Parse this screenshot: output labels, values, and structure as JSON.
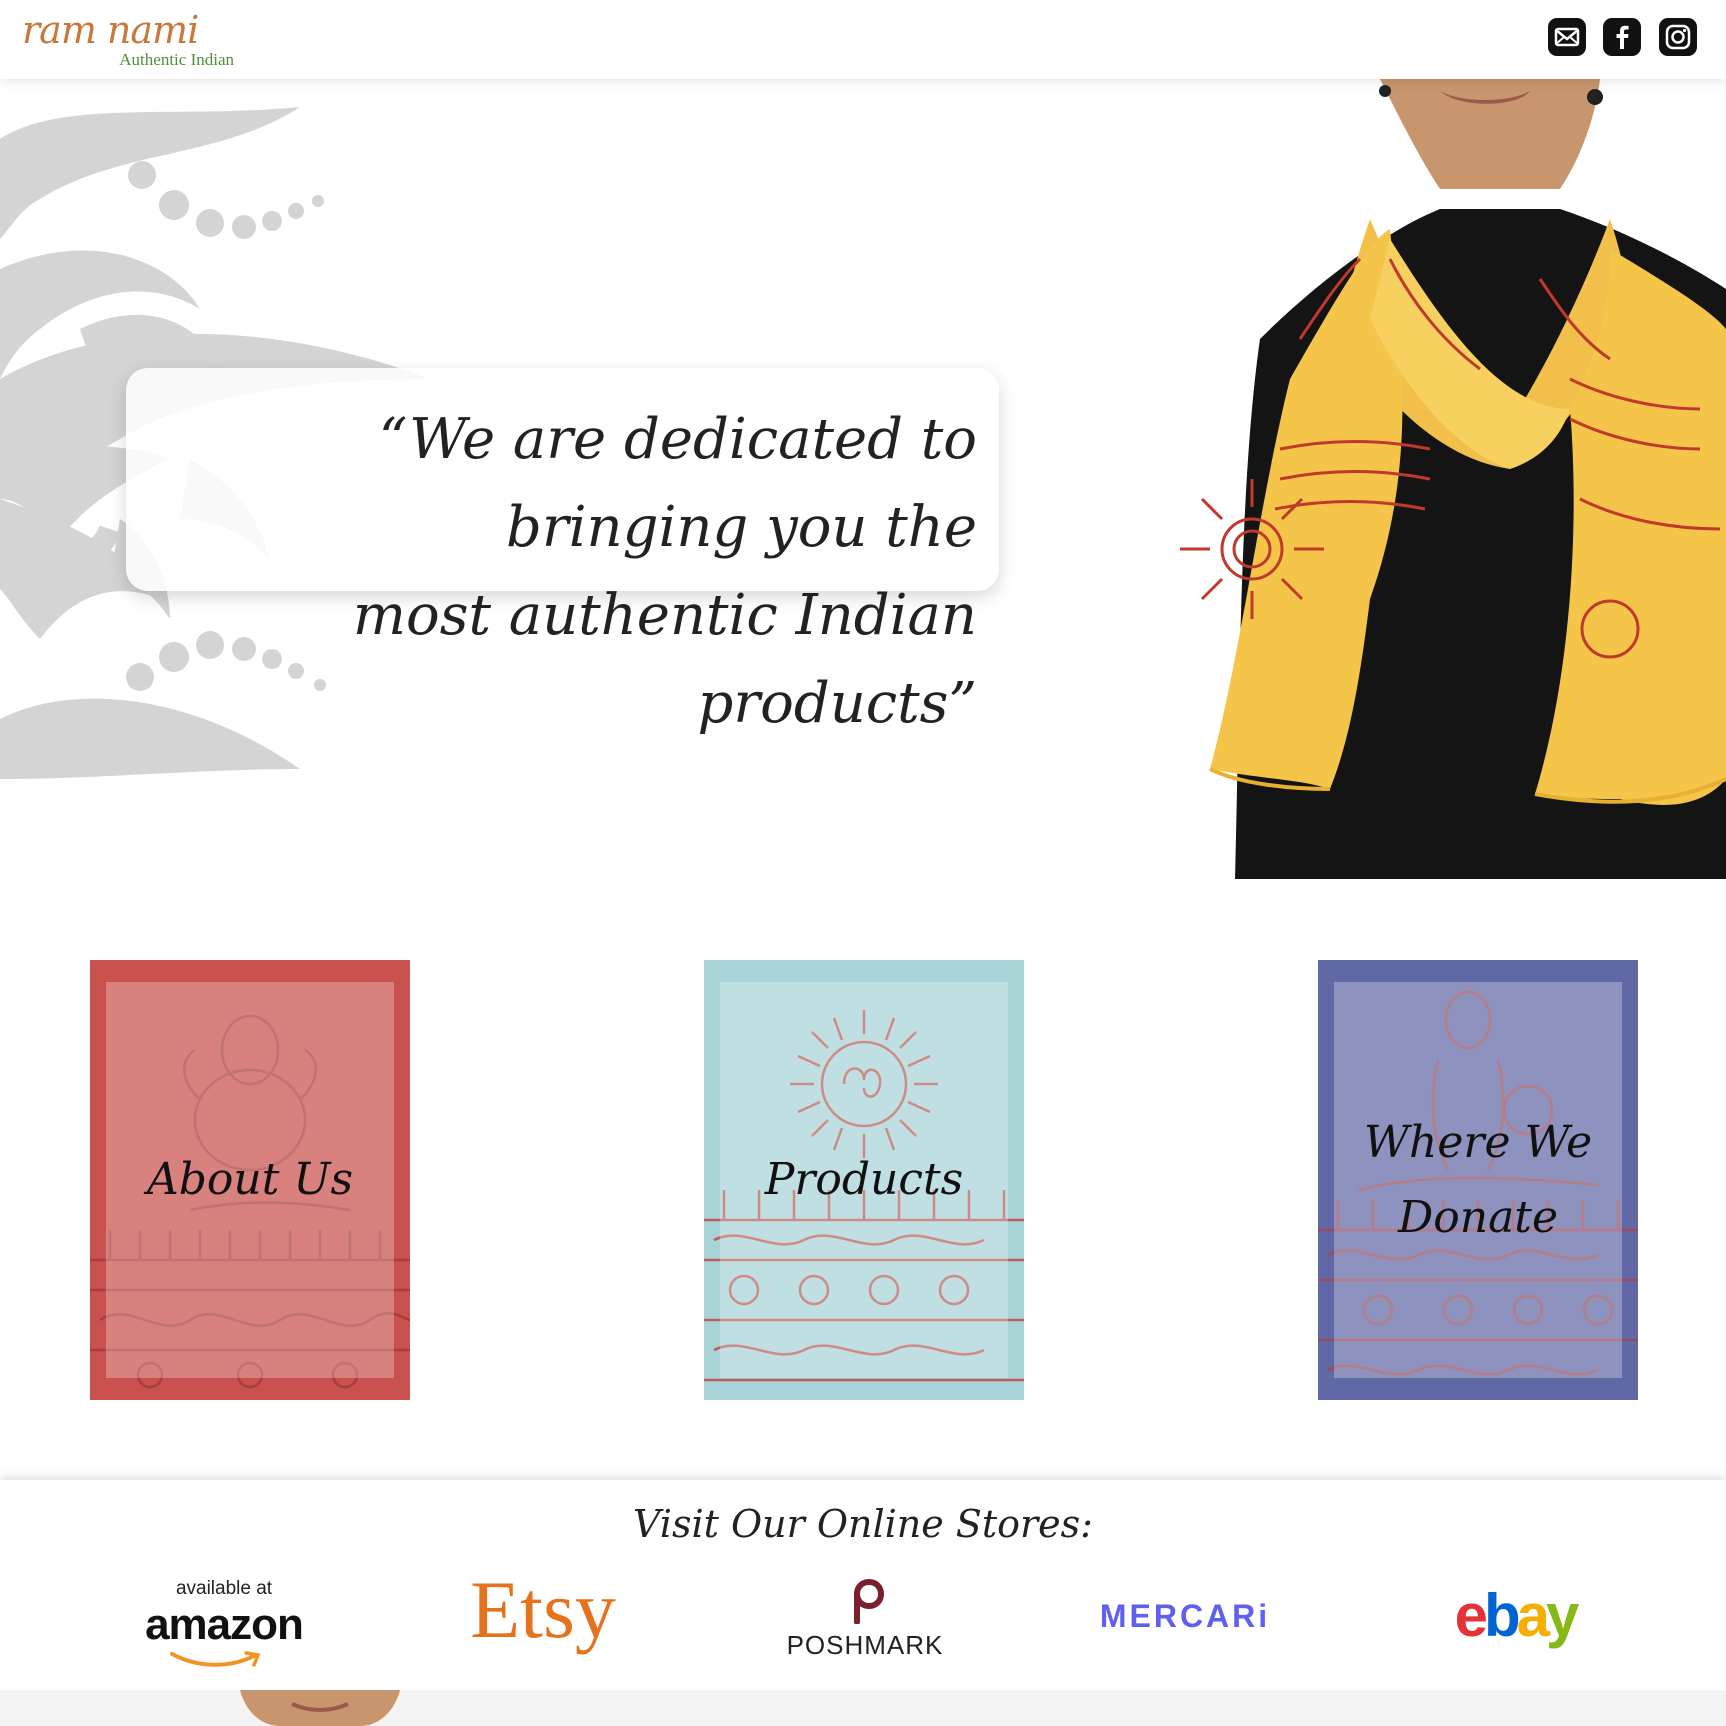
{
  "header": {
    "logo_name": "ram nami",
    "logo_tagline": "Authentic Indian",
    "social_icons": [
      "mail-icon",
      "facebook-icon",
      "instagram-icon"
    ]
  },
  "hero": {
    "quote_line1": "“We are dedicated to bringing you the",
    "quote_line2": "most authentic Indian products”"
  },
  "cards": [
    {
      "label_line1": "About Us",
      "label_line2": "",
      "color": "#c9514e"
    },
    {
      "label_line1": "Products",
      "label_line2": "",
      "color": "#a8d3d8"
    },
    {
      "label_line1": "Where We",
      "label_line2": "Donate",
      "color": "#6168a6"
    }
  ],
  "stores": {
    "title": "Visit Our Online Stores:",
    "amazon_small": "available at",
    "amazon_big": "amazon",
    "etsy": "Etsy",
    "poshmark": "POSHMARK",
    "mercari": "MERCARi",
    "ebay_e": "e",
    "ebay_b": "b",
    "ebay_a": "a",
    "ebay_y": "y"
  },
  "colors": {
    "logo_orange": "#c9773a",
    "logo_green": "#4f8f3a",
    "scarf_yellow": "#f5c54a",
    "print_red": "#c0392b",
    "etsy_orange": "#e5721d",
    "mercari_blue": "#5f5ff0",
    "ebay_red": "#e53238",
    "ebay_blue": "#0064d2",
    "ebay_yellow": "#f5af02",
    "ebay_green": "#86b817"
  }
}
